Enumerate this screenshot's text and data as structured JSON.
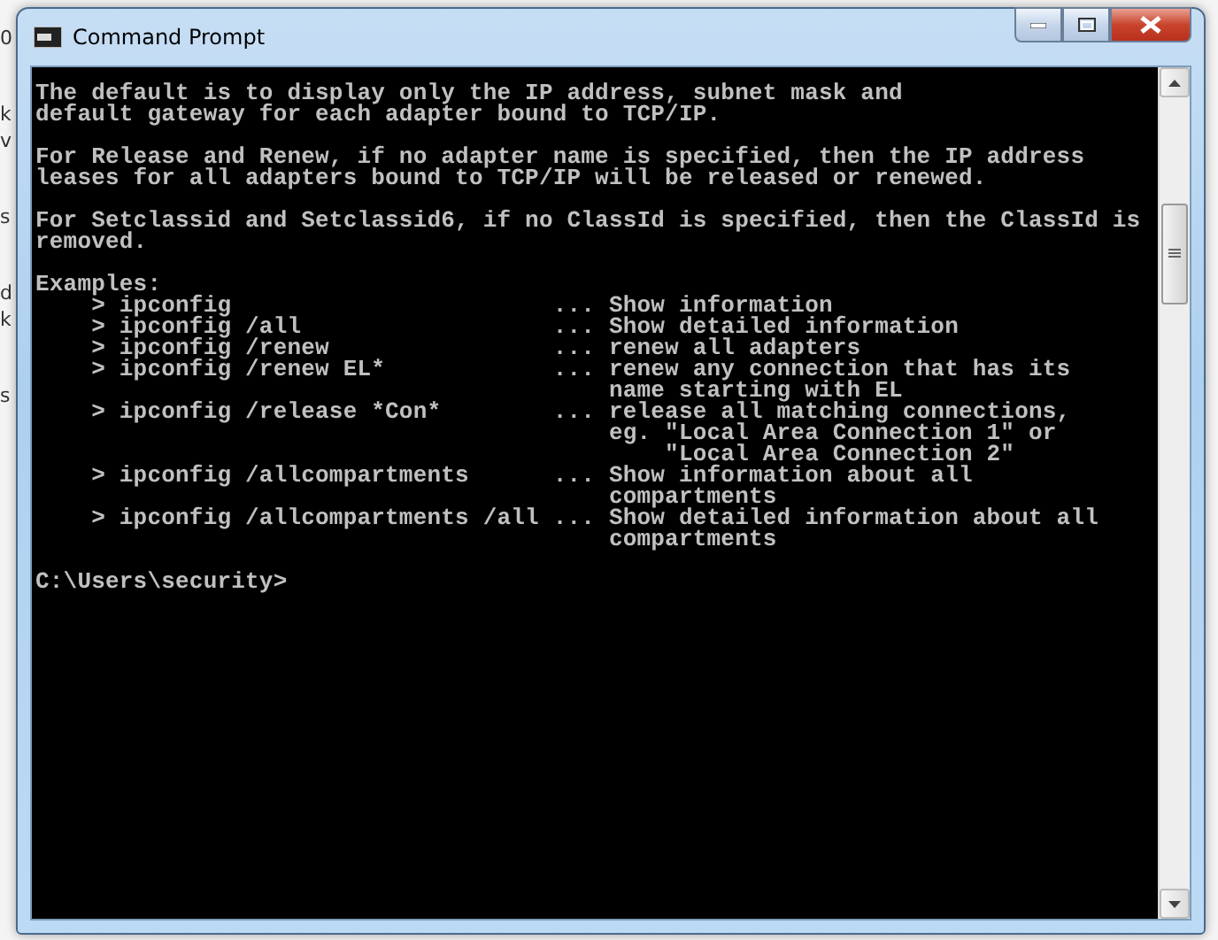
{
  "background_window": {
    "fragment_groups": [
      [
        "0"
      ],
      [
        "k",
        "v"
      ],
      [
        "s"
      ],
      [
        "d",
        "k"
      ],
      [
        "s"
      ]
    ]
  },
  "window": {
    "title": "Command Prompt",
    "controls": [
      {
        "kind": "minimize"
      },
      {
        "kind": "maximize"
      },
      {
        "kind": "close"
      }
    ]
  },
  "console": {
    "blocks": [
      [
        "The default is to display only the IP address, subnet mask and",
        "default gateway for each adapter bound to TCP/IP."
      ],
      [
        "For Release and Renew, if no adapter name is specified, then the IP address",
        "leases for all adapters bound to TCP/IP will be released or renewed."
      ],
      [
        "For Setclassid and Setclassid6, if no ClassId is specified, then the ClassId is",
        "removed."
      ],
      [
        "Examples:",
        "    > ipconfig                       ... Show information",
        "    > ipconfig /all                  ... Show detailed information",
        "    > ipconfig /renew                ... renew all adapters",
        "    > ipconfig /renew EL*            ... renew any connection that has its",
        "                                         name starting with EL",
        "    > ipconfig /release *Con*        ... release all matching connections,",
        "                                         eg. \"Local Area Connection 1\" or",
        "                                             \"Local Area Connection 2\"",
        "    > ipconfig /allcompartments      ... Show information about all",
        "                                         compartments",
        "    > ipconfig /allcompartments /all ... Show detailed information about all",
        "                                         compartments"
      ],
      [
        "C:\\Users\\security>"
      ]
    ]
  }
}
